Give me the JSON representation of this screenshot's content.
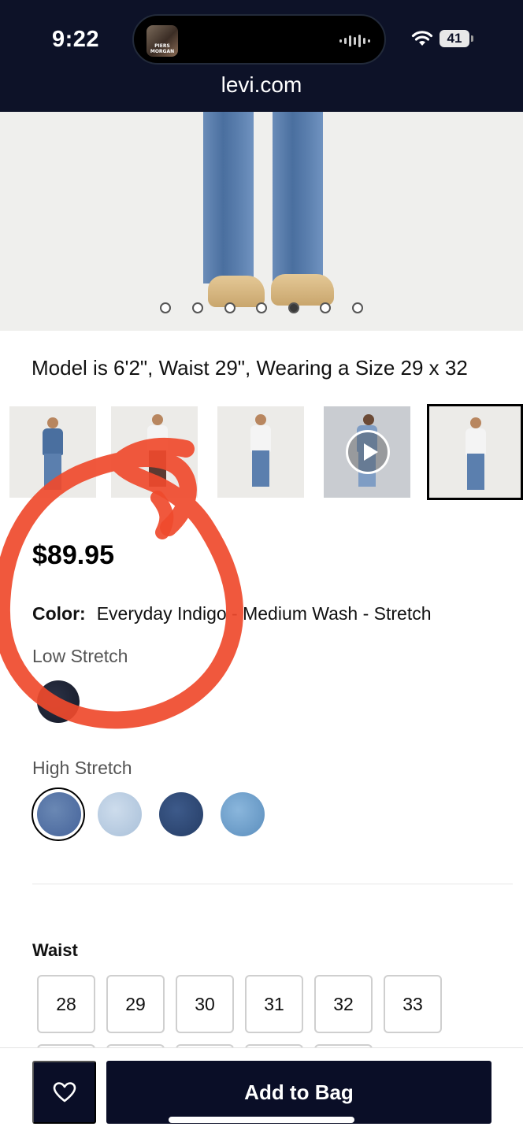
{
  "status_bar": {
    "time": "9:22",
    "battery": "41",
    "now_playing_thumb_text": "PIERS MORGAN"
  },
  "browser": {
    "url": "levi.com"
  },
  "gallery": {
    "dot_count": 7,
    "active_dot_index": 4,
    "caption": "Model is 6'2\", Waist 29\", Wearing a Size 29 x 32",
    "selected_thumbnail_index": 4,
    "video_thumbnail_index": 3
  },
  "product": {
    "price": "$89.95",
    "color_label": "Color:",
    "color_value": "Everyday Indigo - Medium Wash - Stretch",
    "low_stretch_label": "Low Stretch",
    "high_stretch_label": "High Stretch",
    "low_stretch_swatches": [
      "#1f2433"
    ],
    "high_stretch_swatches": [
      "#4f6d9c",
      "#b6cbe0",
      "#2f4a78",
      "#6f9ec8"
    ],
    "selected_high_stretch_index": 0
  },
  "sizes": {
    "waist_label": "Waist",
    "waist_options": [
      "28",
      "29",
      "30",
      "31",
      "32",
      "33"
    ]
  },
  "actions": {
    "add_to_bag": "Add to Bag"
  },
  "colors": {
    "navy": "#0a0e27",
    "annotation_red": "#ef4a2c"
  }
}
